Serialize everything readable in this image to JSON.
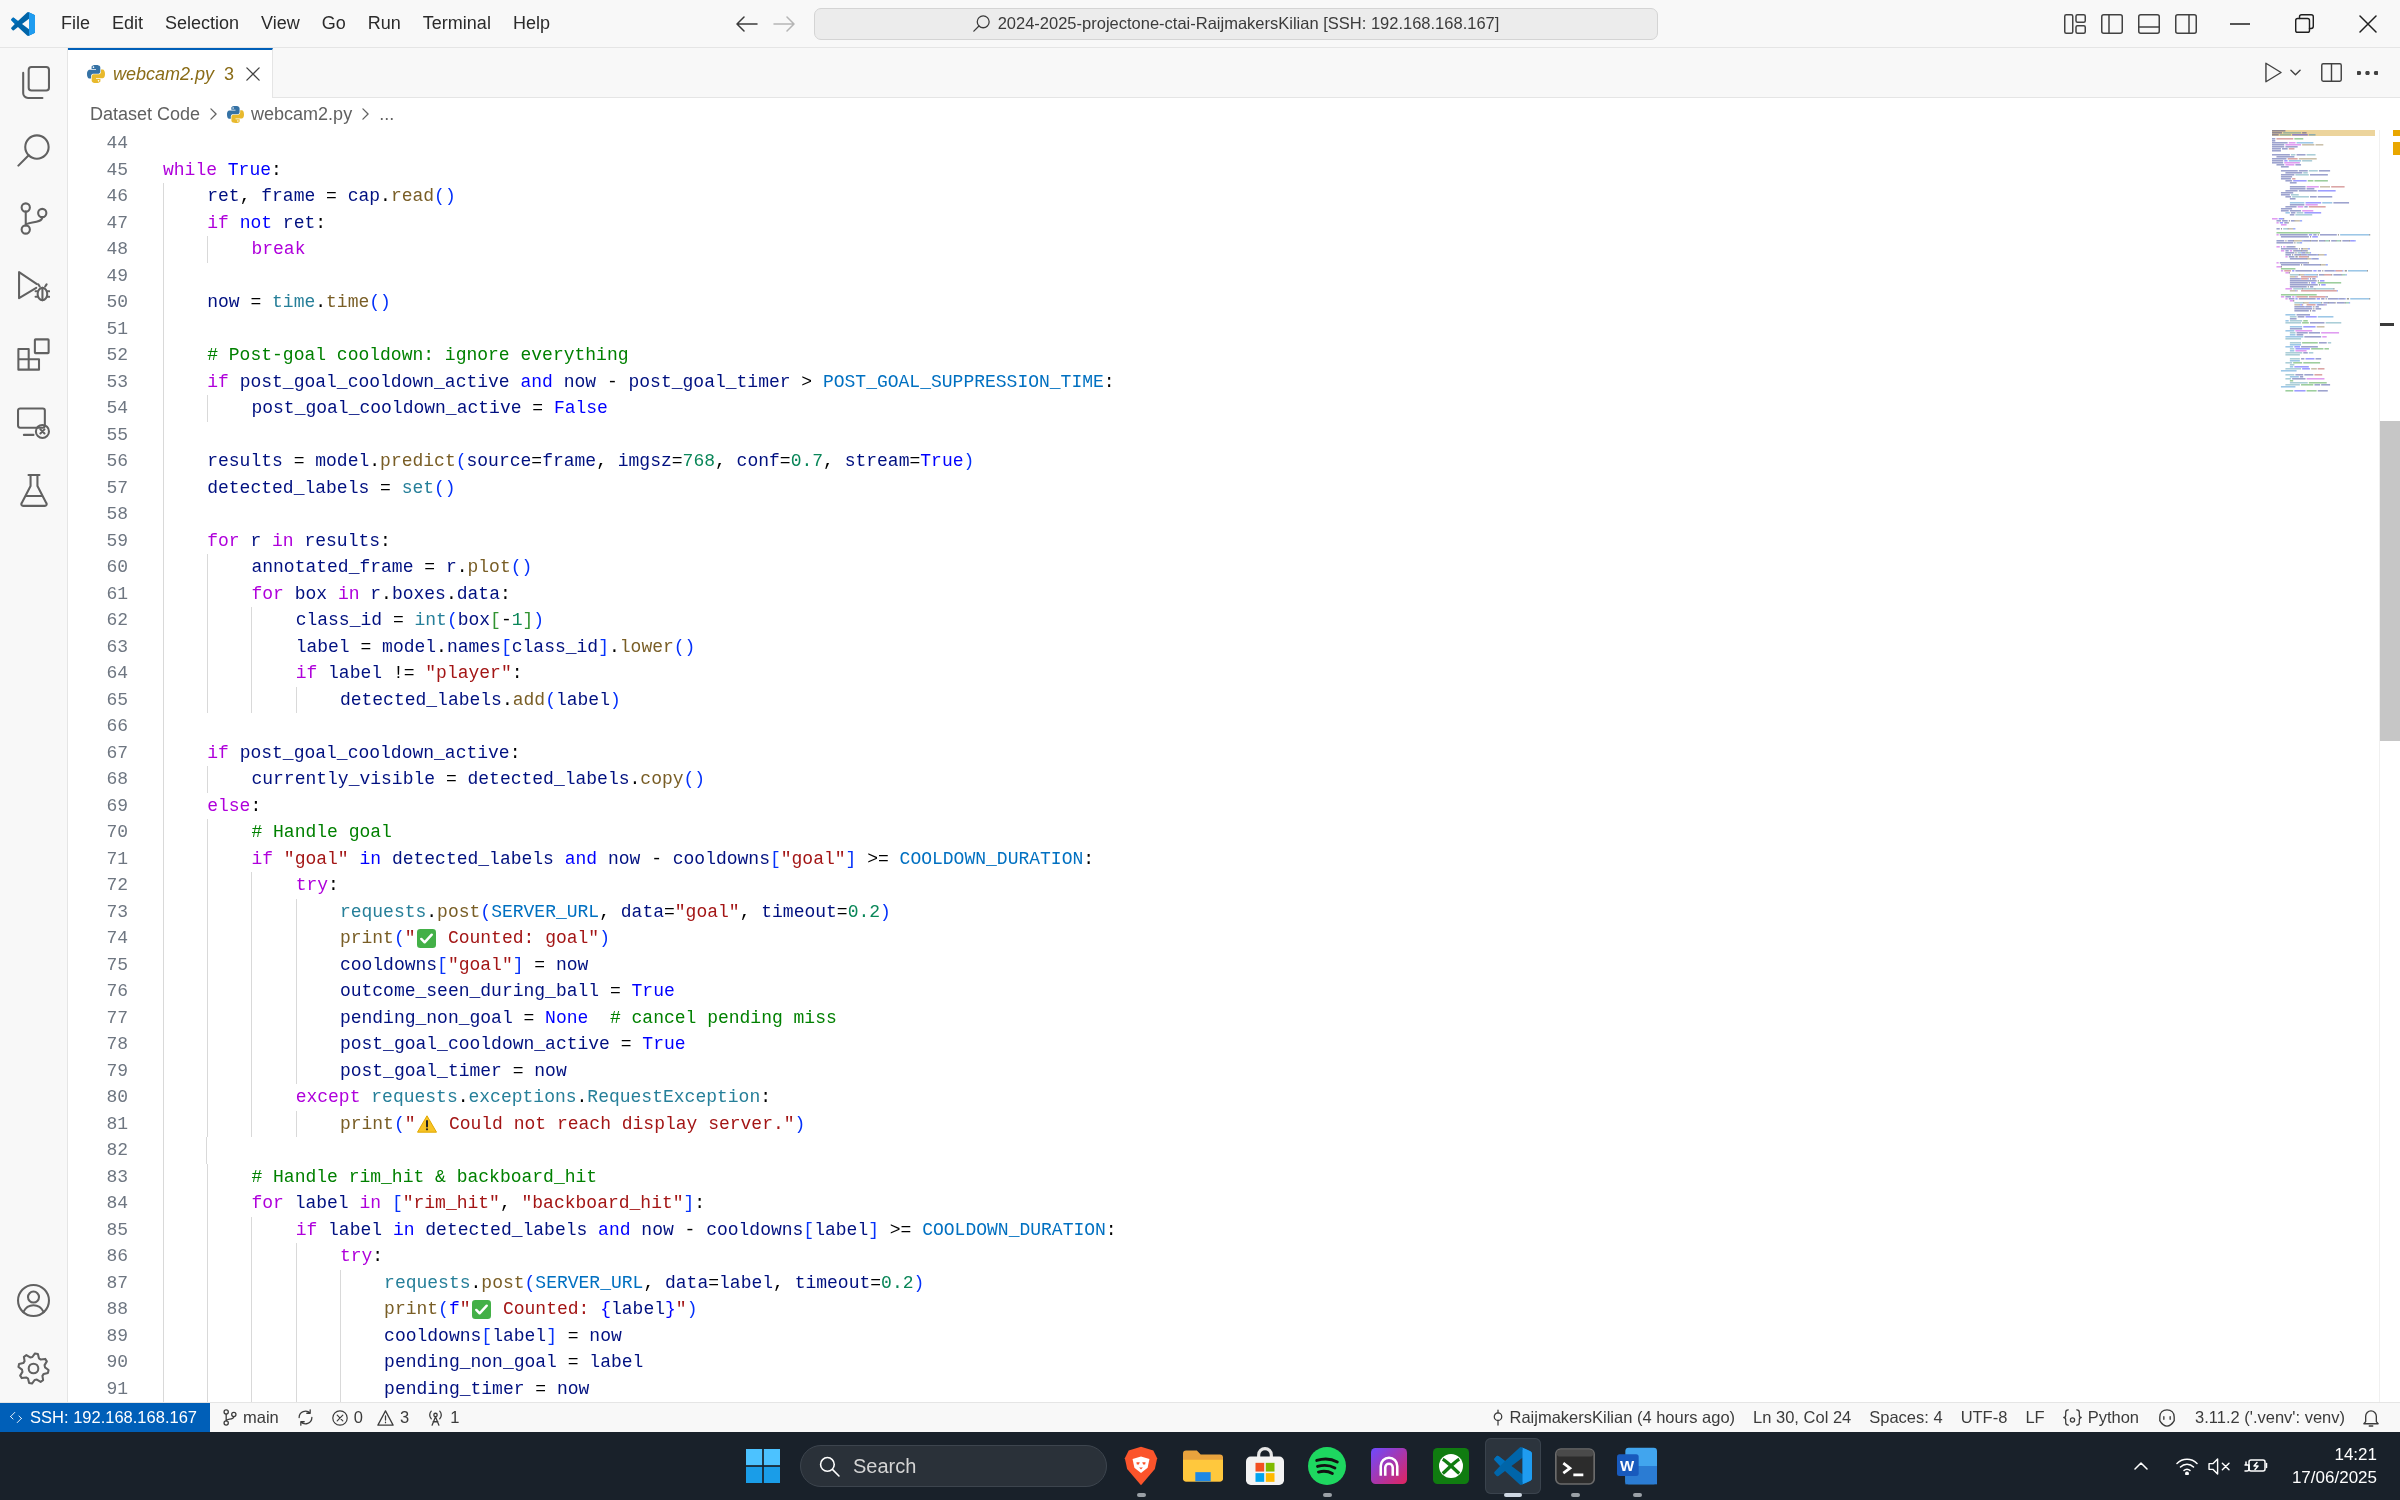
{
  "window": {
    "title": "2024-2025-projectone-ctai-RaijmakersKilian [SSH: 192.168.168.167]"
  },
  "menu": [
    "File",
    "Edit",
    "Selection",
    "View",
    "Go",
    "Run",
    "Terminal",
    "Help"
  ],
  "navigation": [
    {
      "kind": "back",
      "disabled": false
    },
    {
      "kind": "forward",
      "disabled": true
    }
  ],
  "activity_bar": {
    "items": [
      {
        "kind": "explorer",
        "selected": false
      },
      {
        "kind": "search",
        "selected": false
      },
      {
        "kind": "source-control",
        "selected": false
      },
      {
        "kind": "run-debug",
        "selected": false
      },
      {
        "kind": "extensions",
        "selected": false
      },
      {
        "kind": "remote",
        "selected": false
      },
      {
        "kind": "testing",
        "selected": false
      }
    ],
    "bottom": [
      {
        "kind": "accounts"
      },
      {
        "kind": "settings"
      }
    ]
  },
  "tabs": [
    {
      "label": "webcam2.py",
      "problems": "3",
      "warning": true,
      "preview": true,
      "selected": true
    }
  ],
  "breadcrumbs": [
    {
      "label": "Dataset Code",
      "kind": "folder"
    },
    {
      "label": "webcam2.py",
      "kind": "python"
    },
    {
      "label": "...",
      "kind": "symbols"
    }
  ],
  "editor": {
    "lines": [
      {
        "number": "44"
      },
      {
        "number": "45",
        "tokens": [
          {
            "kind": "control",
            "text": "while "
          },
          {
            "kind": "keyword",
            "text": "True"
          },
          {
            "kind": "plain",
            "text": ":"
          }
        ]
      },
      {
        "number": "46",
        "tokens": [
          {
            "kind": "variable",
            "text": "    ret"
          },
          {
            "kind": "plain",
            "text": ", "
          },
          {
            "kind": "variable",
            "text": "frame"
          },
          {
            "kind": "plain",
            "text": " = "
          },
          {
            "kind": "variable",
            "text": "cap"
          },
          {
            "kind": "plain",
            "text": "."
          },
          {
            "kind": "function",
            "text": "read"
          },
          {
            "kind": "bracket1",
            "text": "()"
          }
        ]
      },
      {
        "number": "47",
        "tokens": [
          {
            "kind": "control",
            "text": "    if "
          },
          {
            "kind": "keyword",
            "text": "not "
          },
          {
            "kind": "variable",
            "text": "ret"
          },
          {
            "kind": "plain",
            "text": ":"
          }
        ]
      },
      {
        "number": "48",
        "tokens": [
          {
            "kind": "control",
            "text": "        break"
          }
        ]
      },
      {
        "number": "49"
      },
      {
        "number": "50",
        "tokens": [
          {
            "kind": "variable",
            "text": "    now"
          },
          {
            "kind": "plain",
            "text": " = "
          },
          {
            "kind": "type",
            "text": "time"
          },
          {
            "kind": "plain",
            "text": "."
          },
          {
            "kind": "function",
            "text": "time"
          },
          {
            "kind": "bracket1",
            "text": "()"
          }
        ]
      },
      {
        "number": "51"
      },
      {
        "number": "52",
        "tokens": [
          {
            "kind": "comment",
            "text": "    # Post-goal cooldown: ignore everything"
          }
        ]
      },
      {
        "number": "53",
        "tokens": [
          {
            "kind": "control",
            "text": "    if "
          },
          {
            "kind": "variable",
            "text": "post_goal_cooldown_active "
          },
          {
            "kind": "keyword",
            "text": "and "
          },
          {
            "kind": "variable",
            "text": "now"
          },
          {
            "kind": "plain",
            "text": " - "
          },
          {
            "kind": "variable",
            "text": "post_goal_timer"
          },
          {
            "kind": "plain",
            "text": " > "
          },
          {
            "kind": "constant",
            "text": "POST_GOAL_SUPPRESSION_TIME"
          },
          {
            "kind": "plain",
            "text": ":"
          }
        ]
      },
      {
        "number": "54",
        "tokens": [
          {
            "kind": "variable",
            "text": "        post_goal_cooldown_active"
          },
          {
            "kind": "plain",
            "text": " = "
          },
          {
            "kind": "keyword",
            "text": "False"
          }
        ]
      },
      {
        "number": "55"
      },
      {
        "number": "56",
        "tokens": [
          {
            "kind": "variable",
            "text": "    results"
          },
          {
            "kind": "plain",
            "text": " = "
          },
          {
            "kind": "variable",
            "text": "model"
          },
          {
            "kind": "plain",
            "text": "."
          },
          {
            "kind": "function",
            "text": "predict"
          },
          {
            "kind": "bracket1",
            "text": "("
          },
          {
            "kind": "variable",
            "text": "source"
          },
          {
            "kind": "plain",
            "text": "="
          },
          {
            "kind": "variable",
            "text": "frame"
          },
          {
            "kind": "plain",
            "text": ", "
          },
          {
            "kind": "variable",
            "text": "imgsz"
          },
          {
            "kind": "plain",
            "text": "="
          },
          {
            "kind": "number",
            "text": "768"
          },
          {
            "kind": "plain",
            "text": ", "
          },
          {
            "kind": "variable",
            "text": "conf"
          },
          {
            "kind": "plain",
            "text": "="
          },
          {
            "kind": "number",
            "text": "0.7"
          },
          {
            "kind": "plain",
            "text": ", "
          },
          {
            "kind": "variable",
            "text": "stream"
          },
          {
            "kind": "plain",
            "text": "="
          },
          {
            "kind": "keyword",
            "text": "True"
          },
          {
            "kind": "bracket1",
            "text": ")"
          }
        ]
      },
      {
        "number": "57",
        "tokens": [
          {
            "kind": "variable",
            "text": "    detected_labels"
          },
          {
            "kind": "plain",
            "text": " = "
          },
          {
            "kind": "type",
            "text": "set"
          },
          {
            "kind": "bracket1",
            "text": "()"
          }
        ]
      },
      {
        "number": "58"
      },
      {
        "number": "59",
        "tokens": [
          {
            "kind": "control",
            "text": "    for "
          },
          {
            "kind": "variable",
            "text": "r "
          },
          {
            "kind": "control",
            "text": "in "
          },
          {
            "kind": "variable",
            "text": "results"
          },
          {
            "kind": "plain",
            "text": ":"
          }
        ]
      },
      {
        "number": "60",
        "tokens": [
          {
            "kind": "variable",
            "text": "        annotated_frame"
          },
          {
            "kind": "plain",
            "text": " = "
          },
          {
            "kind": "variable",
            "text": "r"
          },
          {
            "kind": "plain",
            "text": "."
          },
          {
            "kind": "function",
            "text": "plot"
          },
          {
            "kind": "bracket1",
            "text": "()"
          }
        ]
      },
      {
        "number": "61",
        "tokens": [
          {
            "kind": "control",
            "text": "        for "
          },
          {
            "kind": "variable",
            "text": "box "
          },
          {
            "kind": "control",
            "text": "in "
          },
          {
            "kind": "variable",
            "text": "r"
          },
          {
            "kind": "plain",
            "text": "."
          },
          {
            "kind": "variable",
            "text": "boxes"
          },
          {
            "kind": "plain",
            "text": "."
          },
          {
            "kind": "variable",
            "text": "data"
          },
          {
            "kind": "plain",
            "text": ":"
          }
        ]
      },
      {
        "number": "62",
        "tokens": [
          {
            "kind": "variable",
            "text": "            class_id"
          },
          {
            "kind": "plain",
            "text": " = "
          },
          {
            "kind": "type",
            "text": "int"
          },
          {
            "kind": "bracket1",
            "text": "("
          },
          {
            "kind": "variable",
            "text": "box"
          },
          {
            "kind": "bracket2",
            "text": "["
          },
          {
            "kind": "plain",
            "text": "-"
          },
          {
            "kind": "number",
            "text": "1"
          },
          {
            "kind": "bracket2",
            "text": "]"
          },
          {
            "kind": "bracket1",
            "text": ")"
          }
        ]
      },
      {
        "number": "63",
        "tokens": [
          {
            "kind": "variable",
            "text": "            label"
          },
          {
            "kind": "plain",
            "text": " = "
          },
          {
            "kind": "variable",
            "text": "model"
          },
          {
            "kind": "plain",
            "text": "."
          },
          {
            "kind": "variable",
            "text": "names"
          },
          {
            "kind": "bracket1",
            "text": "["
          },
          {
            "kind": "variable",
            "text": "class_id"
          },
          {
            "kind": "bracket1",
            "text": "]"
          },
          {
            "kind": "plain",
            "text": "."
          },
          {
            "kind": "function",
            "text": "lower"
          },
          {
            "kind": "bracket1",
            "text": "()"
          }
        ]
      },
      {
        "number": "64",
        "tokens": [
          {
            "kind": "control",
            "text": "            if "
          },
          {
            "kind": "variable",
            "text": "label"
          },
          {
            "kind": "plain",
            "text": " != "
          },
          {
            "kind": "string",
            "text": "\"player\""
          },
          {
            "kind": "plain",
            "text": ":"
          }
        ]
      },
      {
        "number": "65",
        "tokens": [
          {
            "kind": "variable",
            "text": "                detected_labels"
          },
          {
            "kind": "plain",
            "text": "."
          },
          {
            "kind": "function",
            "text": "add"
          },
          {
            "kind": "bracket1",
            "text": "("
          },
          {
            "kind": "variable",
            "text": "label"
          },
          {
            "kind": "bracket1",
            "text": ")"
          }
        ]
      },
      {
        "number": "66"
      },
      {
        "number": "67",
        "tokens": [
          {
            "kind": "control",
            "text": "    if "
          },
          {
            "kind": "variable",
            "text": "post_goal_cooldown_active"
          },
          {
            "kind": "plain",
            "text": ":"
          }
        ]
      },
      {
        "number": "68",
        "tokens": [
          {
            "kind": "variable",
            "text": "        currently_visible"
          },
          {
            "kind": "plain",
            "text": " = "
          },
          {
            "kind": "variable",
            "text": "detected_labels"
          },
          {
            "kind": "plain",
            "text": "."
          },
          {
            "kind": "function",
            "text": "copy"
          },
          {
            "kind": "bracket1",
            "text": "()"
          }
        ]
      },
      {
        "number": "69",
        "tokens": [
          {
            "kind": "control",
            "text": "    else"
          },
          {
            "kind": "plain",
            "text": ":"
          }
        ]
      },
      {
        "number": "70",
        "tokens": [
          {
            "kind": "comment",
            "text": "        # Handle goal"
          }
        ]
      },
      {
        "number": "71",
        "tokens": [
          {
            "kind": "control",
            "text": "        if "
          },
          {
            "kind": "string",
            "text": "\"goal\" "
          },
          {
            "kind": "keyword",
            "text": "in "
          },
          {
            "kind": "variable",
            "text": "detected_labels "
          },
          {
            "kind": "keyword",
            "text": "and "
          },
          {
            "kind": "variable",
            "text": "now"
          },
          {
            "kind": "plain",
            "text": " - "
          },
          {
            "kind": "variable",
            "text": "cooldowns"
          },
          {
            "kind": "bracket1",
            "text": "["
          },
          {
            "kind": "string",
            "text": "\"goal\""
          },
          {
            "kind": "bracket1",
            "text": "]"
          },
          {
            "kind": "plain",
            "text": " >= "
          },
          {
            "kind": "constant",
            "text": "COOLDOWN_DURATION"
          },
          {
            "kind": "plain",
            "text": ":"
          }
        ]
      },
      {
        "number": "72",
        "tokens": [
          {
            "kind": "control",
            "text": "            try"
          },
          {
            "kind": "plain",
            "text": ":"
          }
        ]
      },
      {
        "number": "73",
        "tokens": [
          {
            "kind": "type",
            "text": "                requests"
          },
          {
            "kind": "plain",
            "text": "."
          },
          {
            "kind": "function",
            "text": "post"
          },
          {
            "kind": "bracket1",
            "text": "("
          },
          {
            "kind": "constant",
            "text": "SERVER_URL"
          },
          {
            "kind": "plain",
            "text": ", "
          },
          {
            "kind": "variable",
            "text": "data"
          },
          {
            "kind": "plain",
            "text": "="
          },
          {
            "kind": "string",
            "text": "\"goal\""
          },
          {
            "kind": "plain",
            "text": ", "
          },
          {
            "kind": "variable",
            "text": "timeout"
          },
          {
            "kind": "plain",
            "text": "="
          },
          {
            "kind": "number",
            "text": "0.2"
          },
          {
            "kind": "bracket1",
            "text": ")"
          }
        ]
      },
      {
        "number": "74",
        "tokens": [
          {
            "kind": "function",
            "text": "                print"
          },
          {
            "kind": "bracket1",
            "text": "("
          },
          {
            "kind": "string",
            "text": "\""
          },
          {
            "kind": "emoji-check"
          },
          {
            "kind": "string",
            "text": " Counted: goal\""
          },
          {
            "kind": "bracket1",
            "text": ")"
          }
        ]
      },
      {
        "number": "75",
        "tokens": [
          {
            "kind": "variable",
            "text": "                cooldowns"
          },
          {
            "kind": "bracket1",
            "text": "["
          },
          {
            "kind": "string",
            "text": "\"goal\""
          },
          {
            "kind": "bracket1",
            "text": "]"
          },
          {
            "kind": "plain",
            "text": " = "
          },
          {
            "kind": "variable",
            "text": "now"
          }
        ]
      },
      {
        "number": "76",
        "tokens": [
          {
            "kind": "variable",
            "text": "                outcome_seen_during_ball"
          },
          {
            "kind": "plain",
            "text": " = "
          },
          {
            "kind": "keyword",
            "text": "True"
          }
        ]
      },
      {
        "number": "77",
        "tokens": [
          {
            "kind": "variable",
            "text": "                pending_non_goal"
          },
          {
            "kind": "plain",
            "text": " = "
          },
          {
            "kind": "keyword",
            "text": "None  "
          },
          {
            "kind": "comment",
            "text": "# cancel pending miss"
          }
        ]
      },
      {
        "number": "78",
        "tokens": [
          {
            "kind": "variable",
            "text": "                post_goal_cooldown_active"
          },
          {
            "kind": "plain",
            "text": " = "
          },
          {
            "kind": "keyword",
            "text": "True"
          }
        ]
      },
      {
        "number": "79",
        "tokens": [
          {
            "kind": "variable",
            "text": "                post_goal_timer"
          },
          {
            "kind": "plain",
            "text": " = "
          },
          {
            "kind": "variable",
            "text": "now"
          }
        ]
      },
      {
        "number": "80",
        "tokens": [
          {
            "kind": "control",
            "text": "            except "
          },
          {
            "kind": "type",
            "text": "requests"
          },
          {
            "kind": "plain",
            "text": "."
          },
          {
            "kind": "type",
            "text": "exceptions"
          },
          {
            "kind": "plain",
            "text": "."
          },
          {
            "kind": "type",
            "text": "RequestException"
          },
          {
            "kind": "plain",
            "text": ":"
          }
        ]
      },
      {
        "number": "81",
        "tokens": [
          {
            "kind": "function",
            "text": "                print"
          },
          {
            "kind": "bracket1",
            "text": "("
          },
          {
            "kind": "string",
            "text": "\""
          },
          {
            "kind": "emoji-warning"
          },
          {
            "kind": "string",
            "text": " Could not reach display server.\""
          },
          {
            "kind": "bracket1",
            "text": ")"
          }
        ]
      },
      {
        "number": "82"
      },
      {
        "number": "83",
        "tokens": [
          {
            "kind": "comment",
            "text": "        # Handle rim_hit & backboard_hit"
          }
        ]
      },
      {
        "number": "84",
        "tokens": [
          {
            "kind": "control",
            "text": "        for "
          },
          {
            "kind": "variable",
            "text": "label "
          },
          {
            "kind": "control",
            "text": "in "
          },
          {
            "kind": "bracket1",
            "text": "["
          },
          {
            "kind": "string",
            "text": "\"rim_hit\""
          },
          {
            "kind": "plain",
            "text": ", "
          },
          {
            "kind": "string",
            "text": "\"backboard_hit\""
          },
          {
            "kind": "bracket1",
            "text": "]"
          },
          {
            "kind": "plain",
            "text": ":"
          }
        ]
      },
      {
        "number": "85",
        "tokens": [
          {
            "kind": "control",
            "text": "            if "
          },
          {
            "kind": "variable",
            "text": "label "
          },
          {
            "kind": "keyword",
            "text": "in "
          },
          {
            "kind": "variable",
            "text": "detected_labels "
          },
          {
            "kind": "keyword",
            "text": "and "
          },
          {
            "kind": "variable",
            "text": "now"
          },
          {
            "kind": "plain",
            "text": " - "
          },
          {
            "kind": "variable",
            "text": "cooldowns"
          },
          {
            "kind": "bracket1",
            "text": "["
          },
          {
            "kind": "variable",
            "text": "label"
          },
          {
            "kind": "bracket1",
            "text": "]"
          },
          {
            "kind": "plain",
            "text": " >= "
          },
          {
            "kind": "constant",
            "text": "COOLDOWN_DURATION"
          },
          {
            "kind": "plain",
            "text": ":"
          }
        ]
      },
      {
        "number": "86",
        "tokens": [
          {
            "kind": "control",
            "text": "                try"
          },
          {
            "kind": "plain",
            "text": ":"
          }
        ]
      },
      {
        "number": "87",
        "tokens": [
          {
            "kind": "type",
            "text": "                    requests"
          },
          {
            "kind": "plain",
            "text": "."
          },
          {
            "kind": "function",
            "text": "post"
          },
          {
            "kind": "bracket1",
            "text": "("
          },
          {
            "kind": "constant",
            "text": "SERVER_URL"
          },
          {
            "kind": "plain",
            "text": ", "
          },
          {
            "kind": "variable",
            "text": "data"
          },
          {
            "kind": "plain",
            "text": "="
          },
          {
            "kind": "variable",
            "text": "label"
          },
          {
            "kind": "plain",
            "text": ", "
          },
          {
            "kind": "variable",
            "text": "timeout"
          },
          {
            "kind": "plain",
            "text": "="
          },
          {
            "kind": "number",
            "text": "0.2"
          },
          {
            "kind": "bracket1",
            "text": ")"
          }
        ]
      },
      {
        "number": "88",
        "tokens": [
          {
            "kind": "function",
            "text": "                    print"
          },
          {
            "kind": "bracket1",
            "text": "("
          },
          {
            "kind": "keyword",
            "text": "f"
          },
          {
            "kind": "string",
            "text": "\""
          },
          {
            "kind": "emoji-check"
          },
          {
            "kind": "string",
            "text": " Counted: "
          },
          {
            "kind": "keyword",
            "text": "{"
          },
          {
            "kind": "variable",
            "text": "label"
          },
          {
            "kind": "keyword",
            "text": "}"
          },
          {
            "kind": "string",
            "text": "\""
          },
          {
            "kind": "bracket1",
            "text": ")"
          }
        ]
      },
      {
        "number": "89",
        "tokens": [
          {
            "kind": "variable",
            "text": "                    cooldowns"
          },
          {
            "kind": "bracket1",
            "text": "["
          },
          {
            "kind": "variable",
            "text": "label"
          },
          {
            "kind": "bracket1",
            "text": "]"
          },
          {
            "kind": "plain",
            "text": " = "
          },
          {
            "kind": "variable",
            "text": "now"
          }
        ]
      },
      {
        "number": "90",
        "tokens": [
          {
            "kind": "variable",
            "text": "                    pending_non_goal"
          },
          {
            "kind": "plain",
            "text": " = "
          },
          {
            "kind": "variable",
            "text": "label"
          }
        ]
      },
      {
        "number": "91",
        "tokens": [
          {
            "kind": "variable",
            "text": "                    pending_timer"
          },
          {
            "kind": "plain",
            "text": " = "
          },
          {
            "kind": "variable",
            "text": "now"
          }
        ]
      }
    ]
  },
  "status_bar": {
    "remote": {
      "label": "SSH: 192.168.168.167"
    },
    "left": [
      {
        "kind": "branch",
        "label": "main"
      },
      {
        "kind": "sync"
      },
      {
        "kind": "problems",
        "errors": "0",
        "warnings": "3"
      },
      {
        "kind": "ports",
        "label": "1"
      }
    ],
    "right": [
      {
        "kind": "blame",
        "label": "RaijmakersKilian (4 hours ago)"
      },
      {
        "kind": "text",
        "label": "Ln 30, Col 24"
      },
      {
        "kind": "text",
        "label": "Spaces: 4"
      },
      {
        "kind": "text",
        "label": "UTF-8"
      },
      {
        "kind": "text",
        "label": "LF"
      },
      {
        "kind": "language",
        "label": "Python"
      },
      {
        "kind": "copilot"
      },
      {
        "kind": "text",
        "label": "3.11.2 ('.venv': venv)"
      },
      {
        "kind": "notifications"
      }
    ]
  },
  "taskbar": {
    "search": {
      "placeholder": "Search"
    },
    "apps": [
      {
        "kind": "shield",
        "running": true,
        "selected": false
      },
      {
        "kind": "folder",
        "running": false,
        "selected": false
      },
      {
        "kind": "bag",
        "running": false,
        "selected": false
      },
      {
        "kind": "waves",
        "running": true,
        "selected": false
      },
      {
        "kind": "arch",
        "running": false,
        "selected": false
      },
      {
        "kind": "sphere",
        "running": false,
        "selected": false
      },
      {
        "kind": "ribbon",
        "running": true,
        "selected": true
      },
      {
        "kind": "terminal",
        "running": true,
        "selected": false
      },
      {
        "kind": "document",
        "letter": "W",
        "running": true,
        "selected": false
      }
    ],
    "tray": [
      {
        "kind": "overflow"
      },
      {
        "kind": "wifi"
      },
      {
        "kind": "volume",
        "muted": true
      },
      {
        "kind": "battery"
      }
    ],
    "clock": {
      "time": "14:21",
      "date": "17/06/2025"
    }
  }
}
